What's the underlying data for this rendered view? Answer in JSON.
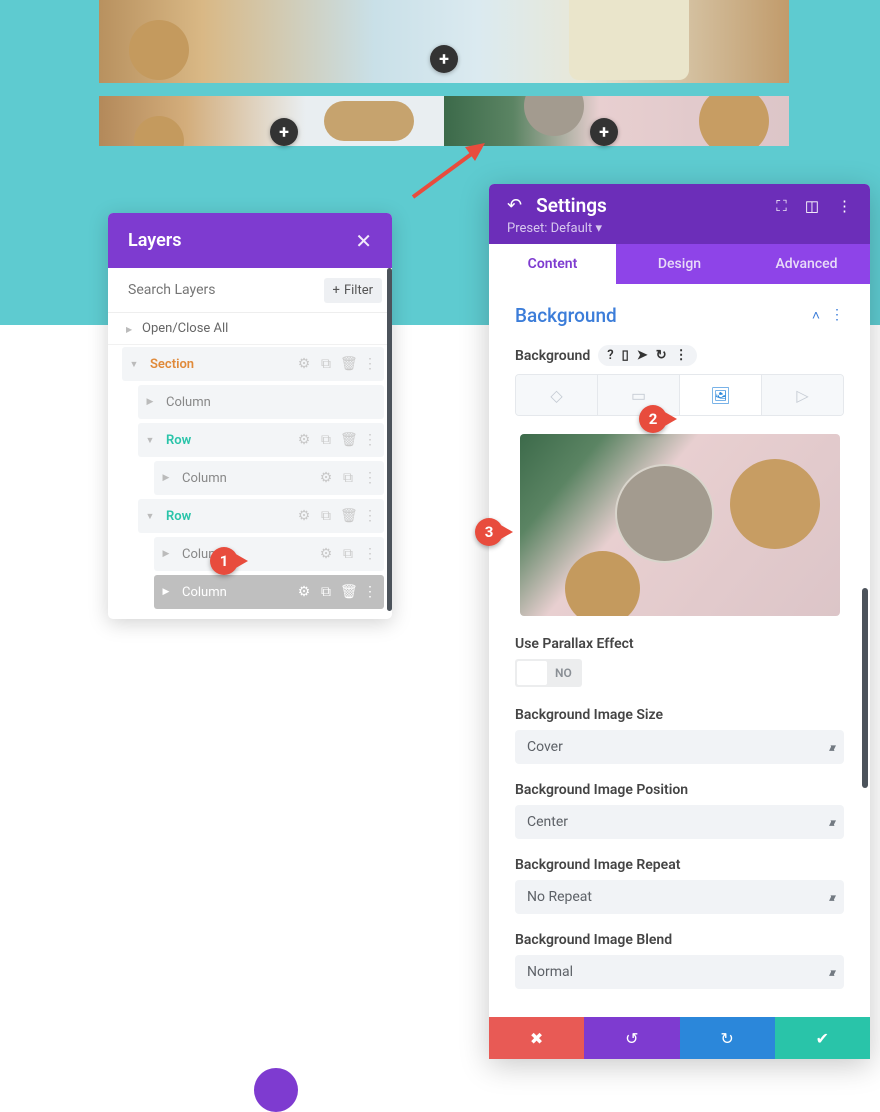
{
  "layers": {
    "title": "Layers",
    "search_placeholder": "Search Layers",
    "filter_label": "Filter",
    "open_close": "Open/Close All",
    "items": {
      "section": "Section",
      "column1": "Column",
      "row1": "Row",
      "column2": "Column",
      "row2": "Row",
      "column3": "Column",
      "column4": "Column"
    }
  },
  "settings": {
    "title": "Settings",
    "preset": "Preset: Default",
    "tabs": {
      "content": "Content",
      "design": "Design",
      "advanced": "Advanced"
    },
    "section": "Background",
    "bg_label": "Background",
    "parallax_label": "Use Parallax Effect",
    "parallax_value": "NO",
    "fields": {
      "size": {
        "label": "Background Image Size",
        "value": "Cover"
      },
      "pos": {
        "label": "Background Image Position",
        "value": "Center"
      },
      "repeat": {
        "label": "Background Image Repeat",
        "value": "No Repeat"
      },
      "blend": {
        "label": "Background Image Blend",
        "value": "Normal"
      }
    }
  },
  "markers": {
    "m1": "1",
    "m2": "2",
    "m3": "3"
  }
}
